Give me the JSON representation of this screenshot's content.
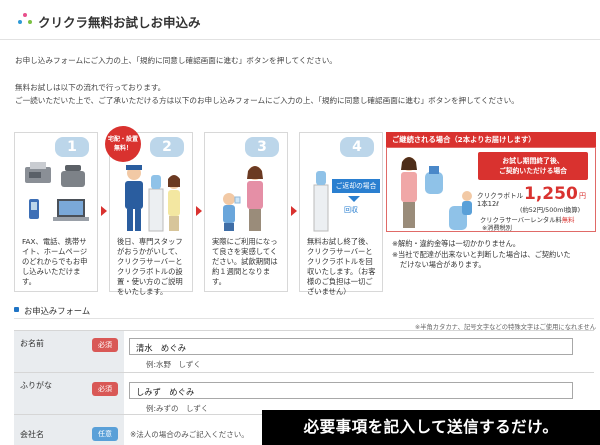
{
  "header": {
    "title": "クリクラ無料お試しお申込み",
    "logo_colors": [
      "#e84f8c",
      "#2f9ad6",
      "#7bc143"
    ]
  },
  "intro": {
    "line1": "お申し込みフォームにご入力の上、「規約に同意し確認画面に進む」ボタンを押してください。",
    "line2": "無料お試しは以下の流れで行っております。",
    "line3": "ご一読いただいた上で、ご了承いただける方は以下のお申し込みフォームにご入力の上、「規約に同意し確認画面に進む」ボタンを押してください。"
  },
  "steps": [
    {
      "num": "1",
      "text": "FAX、電話、携帯サイト、ホームページのどれからでもお申し込みいただけます。"
    },
    {
      "num": "2",
      "text": "後日、専門スタッフがおうかがいして、クリクラサーバーとクリクラボトルの設置・使い方のご説明をいたします。"
    },
    {
      "num": "3",
      "text": "実際にご利用になって良さを実感してください。試飲期間は約１週間となります。"
    },
    {
      "num": "4",
      "text": "無料お試し終了後、クリクラサーバーとクリクラボトルを回収いたします。（お客様のご負担は一切ございません）"
    }
  ],
  "delivery_badge": {
    "line1": "宅配・設置",
    "line2": "無料！"
  },
  "return_panel": {
    "label": "ご返却の場合",
    "sub": "回収"
  },
  "continue": {
    "banner": "ご継続される場合（2本よりお届けします）",
    "callout_line1": "お試し期間終了後、",
    "callout_line2": "ご契約いただける場合",
    "bottle_label_line1": "クリクラボトル",
    "bottle_label_line2": "1本12ℓ",
    "price": "1,250",
    "price_unit": "円",
    "price_sub": "(約52円/500ml換算)",
    "tax_note": "※消費税別",
    "server_rental_prefix": "クリクラサーバーレンタル料",
    "server_rental_free": "無料",
    "note1": "※解約・違約金等は一切かかりません。",
    "note2_line1": "※当社で配達が出来ないと判断した場合は、ご契約いた",
    "note2_line2": "だけない場合があります。"
  },
  "form": {
    "title": "お申込みフォーム",
    "note": "※半角カタカナ、記号文字などの特殊文字はご使用になれません",
    "rows": [
      {
        "label": "お名前",
        "badge": "必須",
        "value": "清水　めぐみ",
        "example": "例:水野　しずく"
      },
      {
        "label": "ふりがな",
        "badge": "必須",
        "value": "しみず　めぐみ",
        "example": "例:みずの　しずく"
      },
      {
        "label": "会社名",
        "badge": "任意",
        "value": "",
        "example": "※法人の場合のみご記入ください。"
      }
    ]
  },
  "caption": "必要事項を記入して送信するだけ。",
  "colors": {
    "accent_red": "#d9322f",
    "step_blue": "#bcd6ea",
    "required": "#d95856",
    "optional": "#5aa0d8",
    "label_bg": "#e9ecef"
  }
}
